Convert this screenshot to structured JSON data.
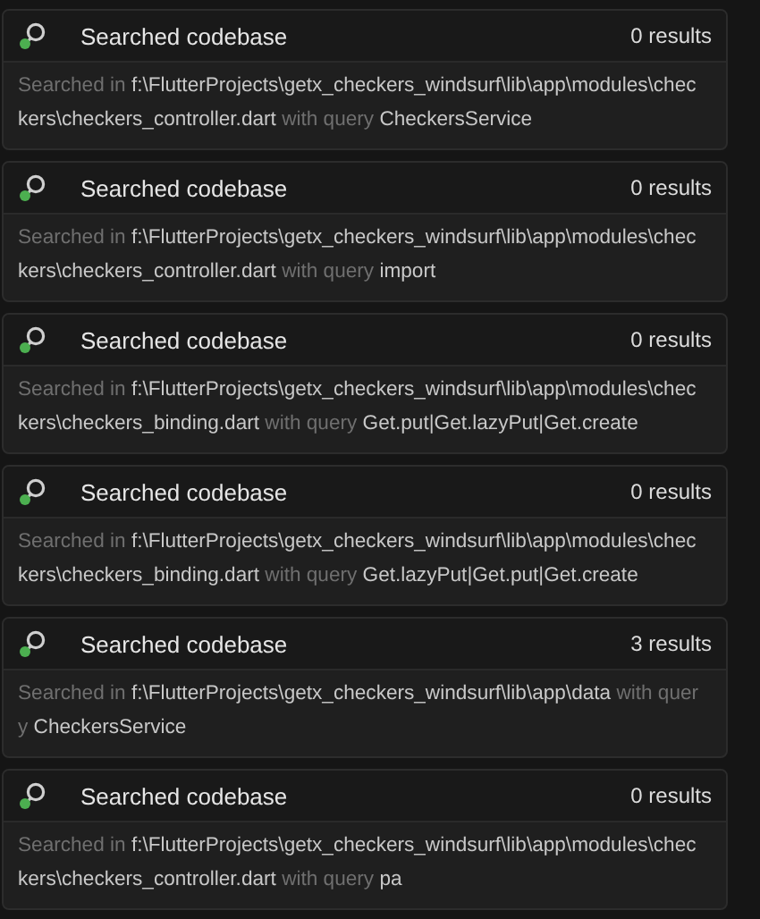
{
  "results": [
    {
      "title": "Searched codebase",
      "count": "0 results",
      "prefix": "Searched in",
      "path": "f:\\FlutterProjects\\getx_checkers_windsurf\\lib\\app\\modules\\checkers\\checkers_controller.dart",
      "joiner": "with query",
      "query": "CheckersService"
    },
    {
      "title": "Searched codebase",
      "count": "0 results",
      "prefix": "Searched in",
      "path": "f:\\FlutterProjects\\getx_checkers_windsurf\\lib\\app\\modules\\checkers\\checkers_controller.dart",
      "joiner": "with query",
      "query": "import"
    },
    {
      "title": "Searched codebase",
      "count": "0 results",
      "prefix": "Searched in",
      "path": "f:\\FlutterProjects\\getx_checkers_windsurf\\lib\\app\\modules\\checkers\\checkers_binding.dart",
      "joiner": "with query",
      "query": "Get.put|Get.lazyPut|Get.create"
    },
    {
      "title": "Searched codebase",
      "count": "0 results",
      "prefix": "Searched in",
      "path": "f:\\FlutterProjects\\getx_checkers_windsurf\\lib\\app\\modules\\checkers\\checkers_binding.dart",
      "joiner": "with query",
      "query": "Get.lazyPut|Get.put|Get.create"
    },
    {
      "title": "Searched codebase",
      "count": "3 results",
      "prefix": "Searched in",
      "path": "f:\\FlutterProjects\\getx_checkers_windsurf\\lib\\app\\data",
      "joiner": "with query",
      "query": "CheckersService"
    },
    {
      "title": "Searched codebase",
      "count": "0 results",
      "prefix": "Searched in",
      "path": "f:\\FlutterProjects\\getx_checkers_windsurf\\lib\\app\\modules\\checkers\\checkers_controller.dart",
      "joiner": "with query",
      "query": "pa"
    }
  ]
}
